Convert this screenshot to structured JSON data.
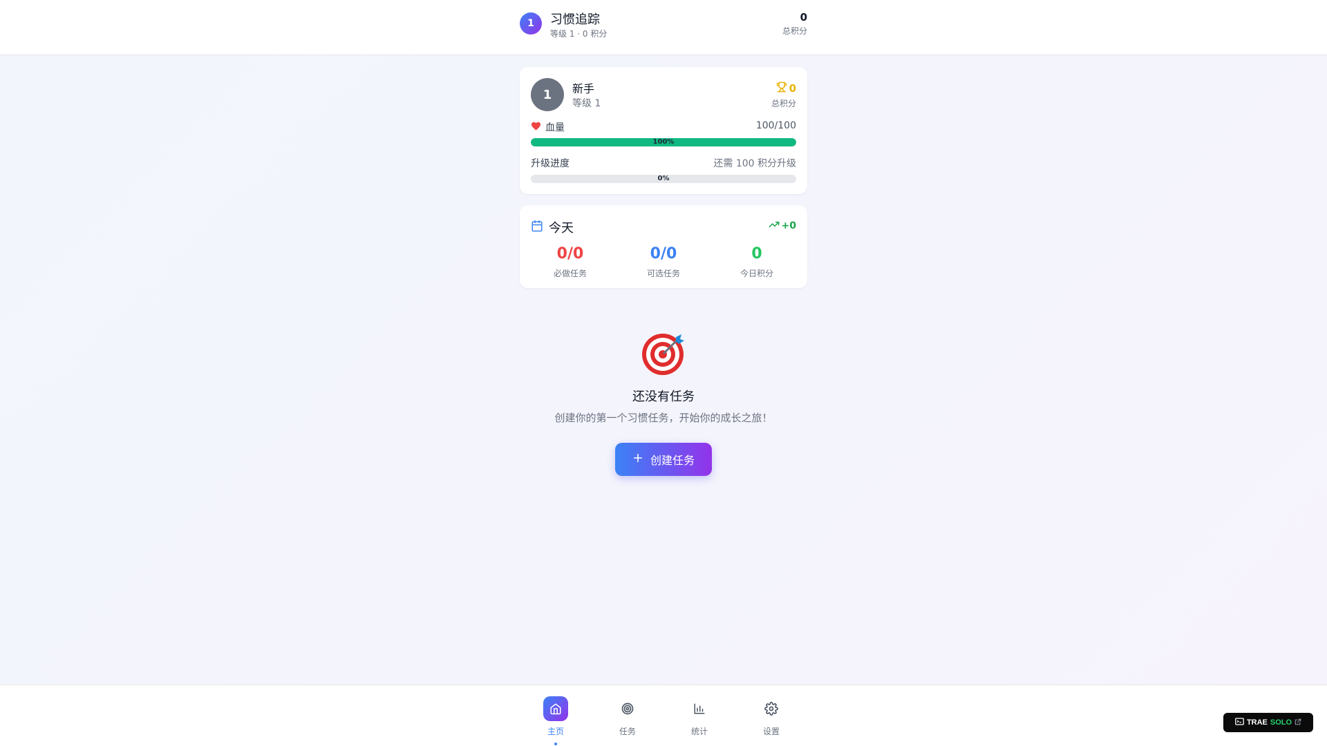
{
  "header": {
    "avatar_level": "1",
    "title": "习惯追踪",
    "subtitle": "等级 1 · 0 积分",
    "total_points": "0",
    "total_points_label": "总积分"
  },
  "profile": {
    "avatar_level": "1",
    "rank_name": "新手",
    "level_text": "等级 1",
    "points": "0",
    "points_label": "总积分",
    "hp_label": "血量",
    "hp_value": "100/100",
    "hp_percent_text": "100%",
    "hp_fraction": 1.0,
    "xp_label": "升级进度",
    "xp_need_text": "还需 100 积分升级",
    "xp_percent_text": "0%",
    "xp_fraction": 0.0
  },
  "today": {
    "title": "今天",
    "gain": "+0",
    "stats": [
      {
        "value": "0/0",
        "label": "必做任务"
      },
      {
        "value": "0/0",
        "label": "可选任务"
      },
      {
        "value": "0",
        "label": "今日积分"
      }
    ]
  },
  "empty_state": {
    "icon": "target-dart-icon",
    "title": "还没有任务",
    "description": "创建你的第一个习惯任务，开始你的成长之旅！",
    "button_label": "创建任务"
  },
  "nav": [
    {
      "label": "主页",
      "icon": "home-icon",
      "active": true
    },
    {
      "label": "任务",
      "icon": "target-icon",
      "active": false
    },
    {
      "label": "统计",
      "icon": "bar-chart-icon",
      "active": false
    },
    {
      "label": "设置",
      "icon": "gear-icon",
      "active": false
    }
  ],
  "badge": {
    "brand": "TRAE",
    "product": "SOLO"
  },
  "colors": {
    "accent_start": "#3b82f6",
    "accent_end": "#9333ea",
    "hp_bar": "#10b981",
    "required_red": "#ef4444",
    "optional_blue": "#3b82f6",
    "points_green": "#22c55e",
    "trophy_gold": "#eab308"
  }
}
